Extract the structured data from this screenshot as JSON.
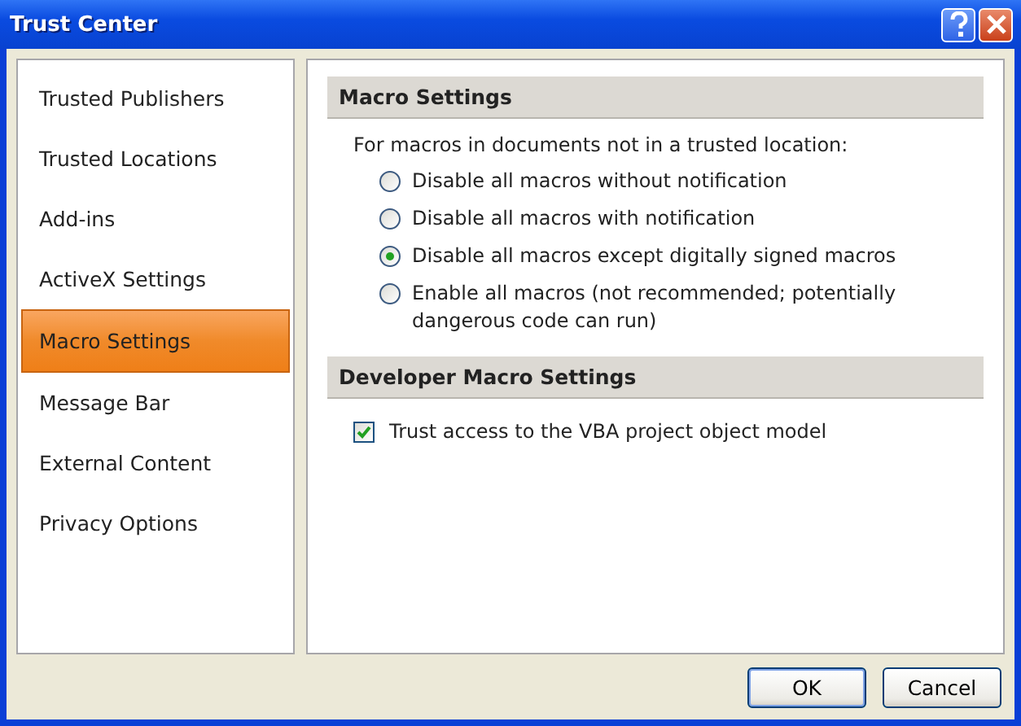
{
  "window": {
    "title": "Trust Center"
  },
  "sidebar": {
    "items": [
      {
        "label": "Trusted Publishers",
        "selected": false
      },
      {
        "label": "Trusted Locations",
        "selected": false
      },
      {
        "label": "Add-ins",
        "selected": false
      },
      {
        "label": "ActiveX Settings",
        "selected": false
      },
      {
        "label": "Macro Settings",
        "selected": true
      },
      {
        "label": "Message Bar",
        "selected": false
      },
      {
        "label": "External Content",
        "selected": false
      },
      {
        "label": "Privacy Options",
        "selected": false
      }
    ]
  },
  "sections": [
    {
      "title": "Macro Settings",
      "intro": "For macros in documents not in a trusted location:",
      "options": [
        {
          "kind": "radio",
          "label": "Disable all macros without notification",
          "selected": false
        },
        {
          "kind": "radio",
          "label": "Disable all macros with notification",
          "selected": false
        },
        {
          "kind": "radio",
          "label": "Disable all macros except digitally signed macros",
          "selected": true
        },
        {
          "kind": "radio",
          "label": "Enable all macros (not recommended; potentially dangerous code can run)",
          "selected": false
        }
      ]
    },
    {
      "title": "Developer Macro Settings",
      "options": [
        {
          "kind": "checkbox",
          "label": "Trust access to the VBA project object model",
          "checked": true
        }
      ]
    }
  ],
  "buttons": [
    "OK",
    "Cancel"
  ]
}
